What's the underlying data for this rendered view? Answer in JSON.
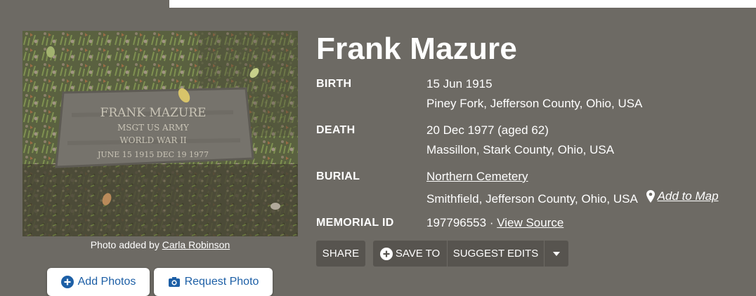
{
  "photo": {
    "alt": "Frank Mazure grave marker",
    "marker_lines": [
      "FRANK   MAZURE",
      "MSGT  US ARMY",
      "WORLD WAR  II",
      "JUNE 15 1915        DEC 19 1977"
    ],
    "credit_prefix": "Photo added by",
    "credit_name": "Carla Robinson",
    "add_photos": "Add Photos",
    "request_photo": "Request Photo"
  },
  "memorial": {
    "name": "Frank Mazure",
    "birth": {
      "label": "BIRTH",
      "date": "15 Jun 1915",
      "place": "Piney Fork, Jefferson County, Ohio, USA"
    },
    "death": {
      "label": "DEATH",
      "date": "20 Dec 1977 (aged 62)",
      "place": "Massillon, Stark County, Ohio, USA"
    },
    "burial": {
      "label": "BURIAL",
      "cemetery": "Northern Cemetery",
      "place": "Smithfield, Jefferson County, Ohio, USA",
      "add_to_map": "Add to Map"
    },
    "memorial_id": {
      "label": "MEMORIAL ID",
      "value": "197796553",
      "separator": " · ",
      "view_source": "View Source"
    }
  },
  "actions": {
    "share": "SHARE",
    "save_to": "SAVE TO",
    "suggest_edits": "SUGGEST EDITS"
  },
  "icons": {
    "plus_circle": "plus-circle-icon",
    "camera": "camera-icon",
    "map_pin": "map-pin-icon",
    "caret": "caret-down-icon"
  },
  "colors": {
    "background": "#6d6a64",
    "button": "#57544f",
    "link_blue": "#1d5fa6",
    "text": "#ffffff"
  }
}
